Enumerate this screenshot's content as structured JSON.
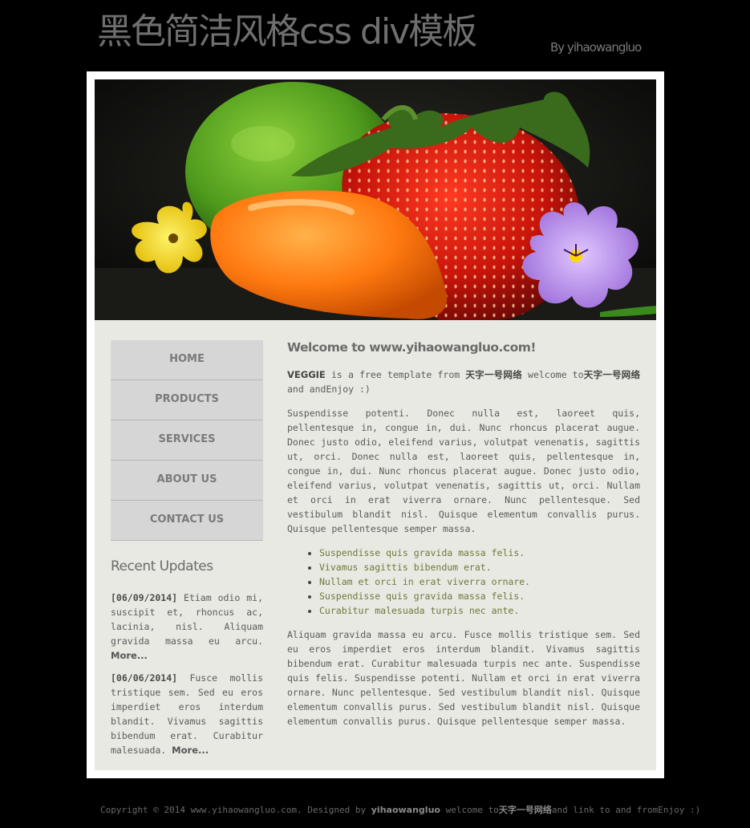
{
  "header": {
    "title": "黑色简洁风格css div模板",
    "byline": "By yihaowangluo"
  },
  "nav": {
    "items": [
      {
        "label": "HOME"
      },
      {
        "label": "PRODUCTS"
      },
      {
        "label": "SERVICES"
      },
      {
        "label": "ABOUT US"
      },
      {
        "label": "CONTACT US"
      }
    ]
  },
  "sidebar": {
    "heading": "Recent Updates",
    "updates": [
      {
        "date": "[06/09/2014]",
        "text": " Etiam odio mi, suscipit et, rhoncus ac, lacinia, nisl. Aliquam gravida massa eu arcu. ",
        "more": "More..."
      },
      {
        "date": "[06/06/2014]",
        "text": " Fusce mollis tristique sem. Sed eu eros imperdiet eros interdum blandit. Vivamus sagittis bibendum erat. Curabitur malesuada. ",
        "more": "More..."
      }
    ]
  },
  "main": {
    "welcome": "Welcome to www.yihaowangluo.com!",
    "intro": {
      "veggie": "VEGGIE",
      "text1": " is a free template from ",
      "brand1": "天字一号网络",
      "text2": " welcome to",
      "brand2": "天字一号网络",
      "text3": " and andEnjoy :)"
    },
    "para1": "Suspendisse potenti. Donec nulla est, laoreet quis, pellentesque in, congue in, dui. Nunc rhoncus placerat augue. Donec justo odio, eleifend varius, volutpat venenatis, sagittis ut, orci. Donec nulla est, laoreet quis, pellentesque in, congue in, dui. Nunc rhoncus placerat augue. Donec justo odio, eleifend varius, volutpat venenatis, sagittis ut, orci. Nullam et orci in erat viverra ornare. Nunc pellentesque. Sed vestibulum blandit nisl. Quisque elementum convallis purus. Quisque pellentesque semper massa.",
    "bullets": [
      "Suspendisse quis gravida massa felis.",
      "Vivamus sagittis bibendum erat.",
      "Nullam et orci in erat viverra ornare.",
      "Suspendisse quis gravida massa felis.",
      "Curabitur malesuada turpis nec ante."
    ],
    "para2": "Aliquam gravida massa eu arcu. Fusce mollis tristique sem. Sed eu eros imperdiet eros interdum blandit. Vivamus sagittis bibendum erat. Curabitur malesuada turpis nec ante. Suspendisse quis felis. Suspendisse potenti. Nullam et orci in erat viverra ornare. Nunc pellentesque. Sed vestibulum blandit nisl. Quisque elementum convallis purus. Sed vestibulum blandit nisl. Quisque elementum convallis purus. Quisque pellentesque semper massa."
  },
  "footer": {
    "copyright": "Copyright © 2014 www.yihaowangluo.com. Designed by ",
    "designer": "yihaowangluo",
    "welcome": " welcome to",
    "brand": "天字一号网络",
    "tail": "and link to and fromEnjoy :)"
  },
  "colors": {
    "page_background": "#000000",
    "content_background": "#e9e9e3",
    "nav_background": "#d6d6d6",
    "list_text": "#6a7a3a"
  },
  "icons": {
    "banner": "fruit-vegetable-photo"
  }
}
